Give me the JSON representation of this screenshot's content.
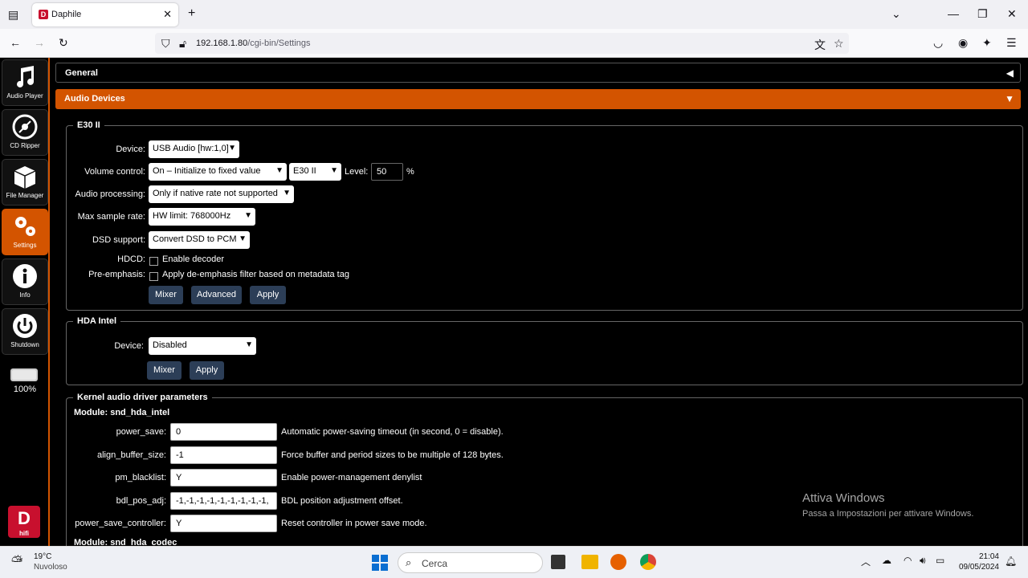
{
  "browser": {
    "tab_title": "Daphile",
    "url_host": "192.168.1.80",
    "url_path": "/cgi-bin/Settings",
    "new_tab": "+",
    "close_tab": "✕"
  },
  "sidebar": {
    "items": [
      {
        "label": "Audio Player",
        "icon": "music-note-icon"
      },
      {
        "label": "CD Ripper",
        "icon": "disc-icon"
      },
      {
        "label": "File Manager",
        "icon": "box-icon"
      },
      {
        "label": "Settings",
        "icon": "gears-icon"
      },
      {
        "label": "Info",
        "icon": "info-icon"
      },
      {
        "label": "Shutdown",
        "icon": "power-icon"
      }
    ],
    "battery_fraction": 1.0,
    "battery_label": "100%",
    "logo_letter": "D",
    "logo_text": "hifi"
  },
  "panels": {
    "general": "General",
    "audio": "Audio Devices",
    "collapse_arrow": "◀",
    "expand_arrow": "▼"
  },
  "e30": {
    "legend": "E30 II",
    "device_label": "Device:",
    "device_value": "USB Audio [hw:1,0]",
    "volume_label": "Volume control:",
    "volume_value": "On – Initialize to fixed value",
    "volume_mixer": "E30 II",
    "level_label": "Level:",
    "level_value": "50",
    "level_unit": "%",
    "processing_label": "Audio processing:",
    "processing_value": "Only if native rate not supported",
    "samplerate_label": "Max sample rate:",
    "samplerate_value": "HW limit: 768000Hz",
    "dsd_label": "DSD support:",
    "dsd_value": "Convert DSD to PCM",
    "hdcd_label": "HDCD:",
    "hdcd_text": "Enable decoder",
    "preemph_label": "Pre-emphasis:",
    "preemph_text": "Apply de-emphasis filter based on metadata tag",
    "btn_mixer": "Mixer",
    "btn_advanced": "Advanced",
    "btn_apply": "Apply"
  },
  "hda": {
    "legend": "HDA Intel",
    "device_label": "Device:",
    "device_value": "Disabled",
    "btn_mixer": "Mixer",
    "btn_apply": "Apply"
  },
  "kernel": {
    "legend": "Kernel audio driver parameters",
    "module1": "Module: snd_hda_intel",
    "params": [
      {
        "name": "power_save:",
        "value": "0",
        "desc": "Automatic power-saving timeout (in second, 0 = disable)."
      },
      {
        "name": "align_buffer_size:",
        "value": "-1",
        "desc": "Force buffer and period sizes to be multiple of 128 bytes."
      },
      {
        "name": "pm_blacklist:",
        "value": "Y",
        "desc": "Enable power-management denylist"
      },
      {
        "name": "bdl_pos_adj:",
        "value": "-1,-1,-1,-1,-1,-1,-1,-1,-1,",
        "desc": "BDL position adjustment offset."
      },
      {
        "name": "power_save_controller:",
        "value": "Y",
        "desc": "Reset controller in power save mode."
      }
    ],
    "module2": "Module: snd_hda_codec"
  },
  "watermark": {
    "title": "Attiva Windows",
    "subtitle": "Passa a Impostazioni per attivare Windows."
  },
  "taskbar": {
    "weather_temp": "19°C",
    "weather_desc": "Nuvoloso",
    "search_placeholder": "Cerca",
    "time": "21:04",
    "date": "09/05/2024"
  }
}
